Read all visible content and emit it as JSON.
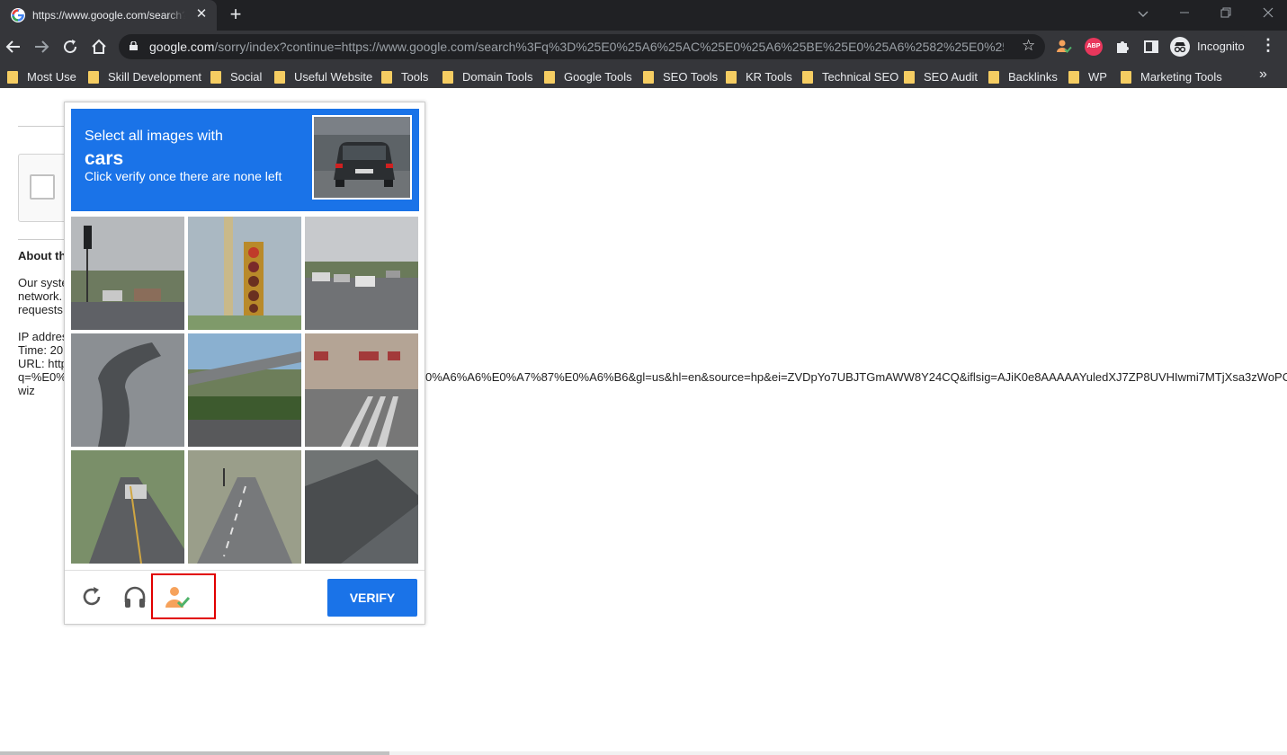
{
  "browser": {
    "tab_title": "https://www.google.com/search?",
    "tab_close": "✕",
    "new_tab": "+",
    "url_host": "google.com",
    "url_path": "/sorry/index?continue=https://www.google.com/search%3Fq%3D%25E0%25A6%25AC%25E0%25A6%25BE%25E0%25A6%2582%25E0%25A6...",
    "incognito_label": "Incognito",
    "abp_label": "ABP",
    "bookmarks": [
      "Most Use",
      "Skill Development",
      "Social",
      "Useful Website",
      "Tools",
      "Domain Tools",
      "Google Tools",
      "SEO Tools",
      "KR Tools",
      "Technical SEO",
      "SEO Audit",
      "Backlinks",
      "WP",
      "Marketing Tools"
    ],
    "bookmarks_more": "»"
  },
  "page": {
    "about_heading": "About th",
    "body_lines": [
      "Our syste",
      "network.",
      "requests"
    ],
    "ip_line": "IP addres",
    "time_line": "Time: 20",
    "url_line": "URL: http",
    "url_q_line": "q=%E0%",
    "url_tail": "0%A6%A6%E0%A7%87%E0%A6%B6&gl=us&hl=en&source=hp&ei=ZVDpYo7UBJTGmAWW8Y24CQ&iflsig=AJiK0e8AAAAAYuledXJ7ZP8UVHIwmi7MTjXsa3zWoPC",
    "wiz_line": "wiz"
  },
  "captcha": {
    "instruction_line1": "Select all images with",
    "keyword": "cars",
    "instruction_line3": "Click verify once there are none left",
    "verify_label": "VERIFY",
    "tiles": [
      {
        "icon": "street-traffic-light-icon"
      },
      {
        "icon": "traffic-light-closeup-icon"
      },
      {
        "icon": "parking-lot-cars-icon"
      },
      {
        "icon": "tree-trunk-icon"
      },
      {
        "icon": "highway-overpass-icon"
      },
      {
        "icon": "crosswalk-building-icon"
      },
      {
        "icon": "road-with-car-icon"
      },
      {
        "icon": "road-intersection-icon"
      },
      {
        "icon": "rooftop-icon"
      }
    ]
  },
  "colors": {
    "accent": "#1a73e8",
    "chrome_dark": "#202124",
    "chrome_toolbar": "#35363a",
    "highlight_red": "#e10000"
  }
}
